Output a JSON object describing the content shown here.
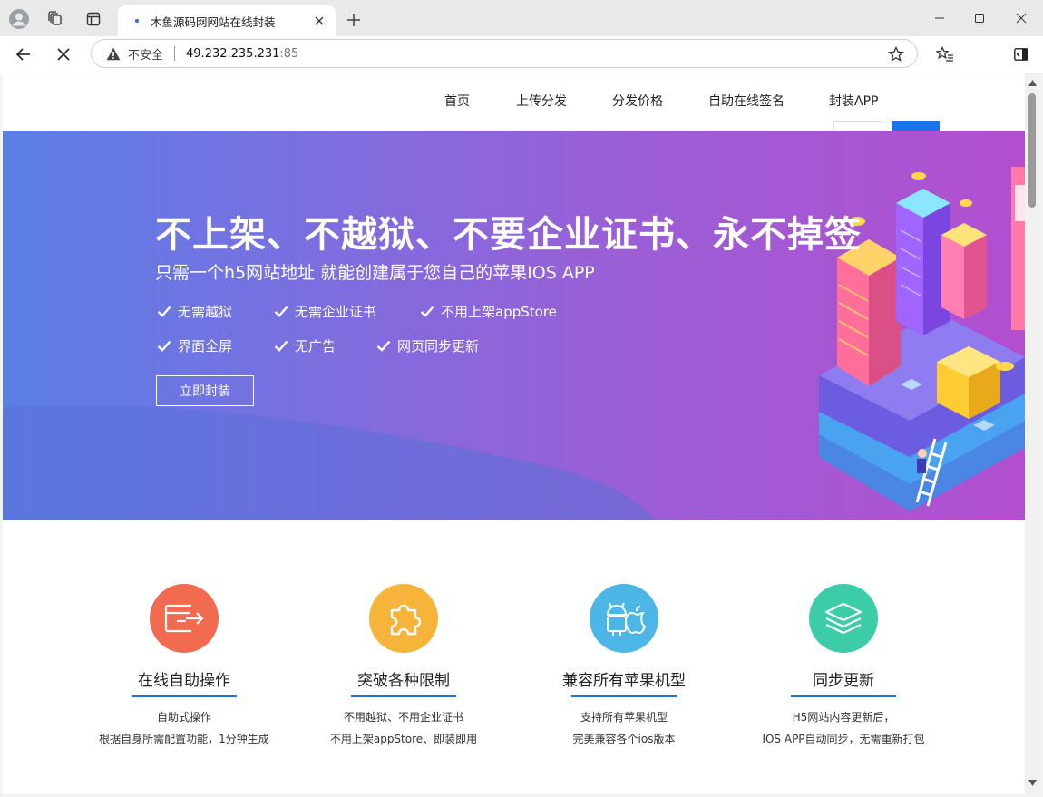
{
  "browser": {
    "tab_title": "木鱼源码网网站在线封装",
    "insecure_label": "不安全",
    "url_host": "49.232.235.231",
    "url_port": ":85"
  },
  "nav": {
    "items": [
      "首页",
      "上传分发",
      "分发价格",
      "自助在线签名",
      "封装APP"
    ]
  },
  "hero": {
    "headline": "不上架、不越狱、不要企业证书、永不掉签",
    "subtitle": "只需一个h5网站地址 就能创建属于您自己的苹果IOS APP",
    "features": [
      "无需越狱",
      "无需企业证书",
      "不用上架appStore",
      "界面全屏",
      "无广告",
      "网页同步更新"
    ],
    "cta_label": "立即封装"
  },
  "services": [
    {
      "title": "在线自助操作",
      "line1": "自助式操作",
      "line2": "根据自身所需配置功能，1分钟生成",
      "color": "#f26a4f",
      "icon": "card-arrow-icon"
    },
    {
      "title": "突破各种限制",
      "line1": "不用越狱、不用企业证书",
      "line2": "不用上架appStore、即装即用",
      "color": "#f6b43a",
      "icon": "puzzle-icon"
    },
    {
      "title": "兼容所有苹果机型",
      "line1": "支持所有苹果机型",
      "line2": "完美兼容各个ios版本",
      "color": "#4cb6e6",
      "icon": "android-apple-icon"
    },
    {
      "title": "同步更新",
      "line1": "H5网站内容更新后，",
      "line2": "IOS APP自动同步，无需重新打包",
      "color": "#3dcca8",
      "icon": "layers-icon"
    }
  ],
  "colors": {
    "accent": "#1e6fd9",
    "hero_gradient_start": "#5a7fe6",
    "hero_gradient_end": "#b24fcf"
  }
}
